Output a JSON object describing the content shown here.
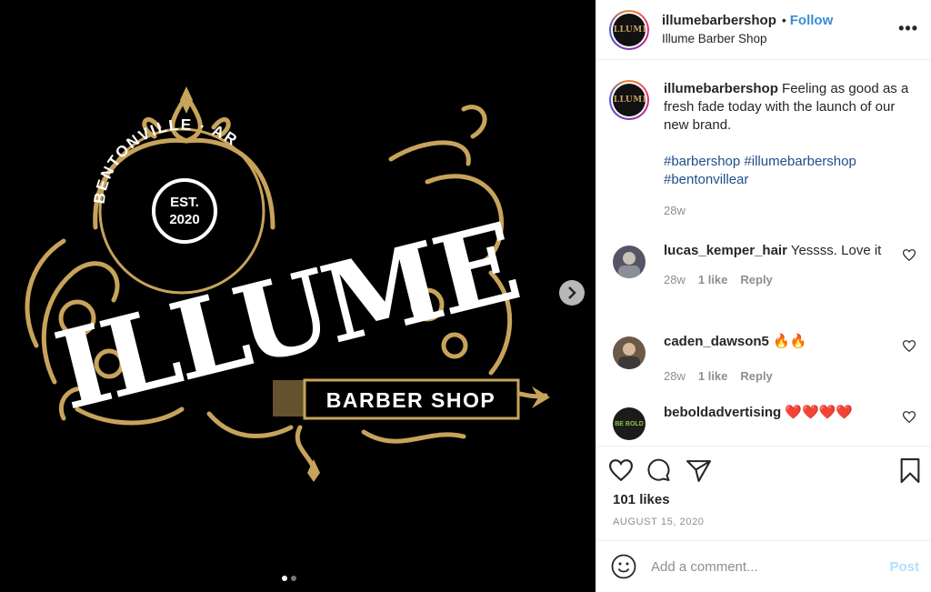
{
  "post": {
    "image": {
      "location_text": "BENTONVILLE · AR",
      "est_line1": "EST.",
      "est_line2": "2020",
      "brand": "ILLUME",
      "subtitle": "BARBER SHOP",
      "gold": "#c7a35b"
    },
    "carousel": {
      "count": 2,
      "active": 0
    }
  },
  "header": {
    "username": "illumebarbershop",
    "separator": "•",
    "follow_label": "Follow",
    "subname": "Illume Barber Shop",
    "more_label": "•••"
  },
  "caption": {
    "username": "illumebarbershop",
    "text": "Feeling as good as a fresh fade today with the launch of our new brand.",
    "hashtags": "#barbershop #illumebarbershop #bentonvillear",
    "time": "28w"
  },
  "comments": [
    {
      "username": "lucas_kemper_hair",
      "text": "Yessss. Love it",
      "time": "28w",
      "likes": "1 like",
      "reply": "Reply"
    },
    {
      "username": "caden_dawson5",
      "text": "🔥🔥",
      "time": "28w",
      "likes": "1 like",
      "reply": "Reply"
    },
    {
      "username": "beboldadvertising",
      "text": "❤️❤️❤️❤️",
      "avatar_text": "BE BOLD"
    }
  ],
  "actions": {
    "likes": "101 likes",
    "date": "AUGUST 15, 2020"
  },
  "add_comment": {
    "placeholder": "Add a comment...",
    "post_label": "Post"
  }
}
